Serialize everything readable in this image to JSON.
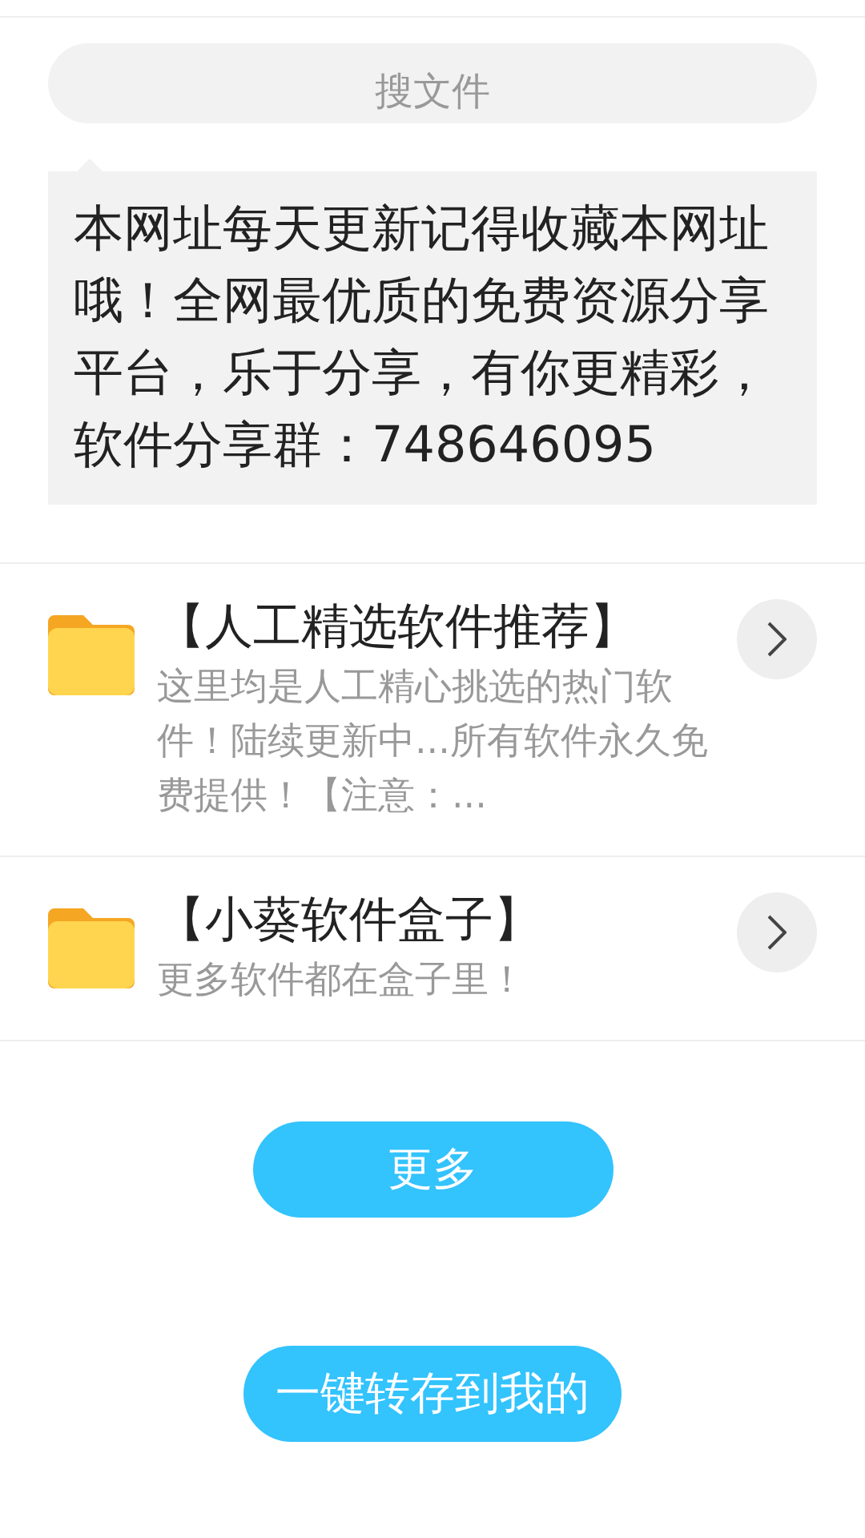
{
  "search": {
    "placeholder": "搜文件"
  },
  "notice": "本网址每天更新记得收藏本网址哦！全网最优质的免费资源分享平台，乐于分享，有你更精彩，软件分享群：748646095",
  "folders": [
    {
      "title": "【人工精选软件推荐】",
      "description": "这里均是人工精心挑选的热门软件！陆续更新中...所有软件永久免费提供！【注意：..."
    },
    {
      "title": "【小葵软件盒子】",
      "description": "更多软件都在盒子里！"
    }
  ],
  "buttons": [
    "更多",
    "一键转存到我的"
  ]
}
